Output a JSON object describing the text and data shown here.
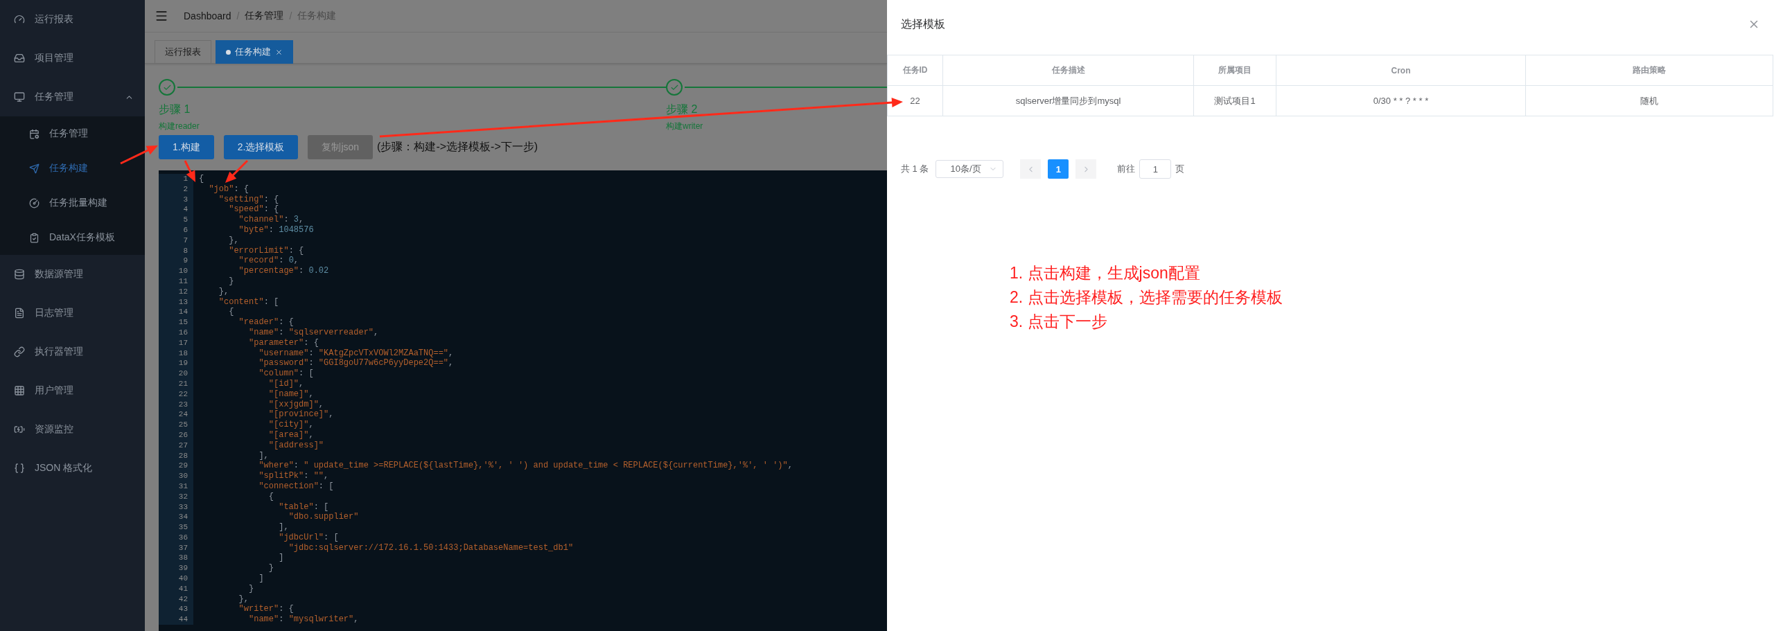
{
  "sidebar": {
    "items": [
      {
        "label": "运行报表",
        "selected": false
      },
      {
        "label": "项目管理",
        "selected": false
      },
      {
        "label": "任务管理",
        "selected": false,
        "expanded": true,
        "children": [
          {
            "label": "任务管理",
            "selected": false
          },
          {
            "label": "任务构建",
            "selected": true
          },
          {
            "label": "任务批量构建",
            "selected": false
          },
          {
            "label": "DataX任务模板",
            "selected": false
          }
        ]
      },
      {
        "label": "数据源管理",
        "selected": false
      },
      {
        "label": "日志管理",
        "selected": false
      },
      {
        "label": "执行器管理",
        "selected": false
      },
      {
        "label": "用户管理",
        "selected": false
      },
      {
        "label": "资源监控",
        "selected": false
      },
      {
        "label": "JSON 格式化",
        "selected": false
      }
    ]
  },
  "breadcrumb": [
    "Dashboard",
    "任务管理",
    "任务构建"
  ],
  "breadcrumb_separator": "/",
  "tabs": [
    {
      "label": "运行报表",
      "selected": false
    },
    {
      "label": "任务构建",
      "selected": true
    }
  ],
  "steps": [
    {
      "title": "步骤 1",
      "description": "构建reader",
      "done": true
    },
    {
      "title": "步骤 2",
      "description": "构建writer",
      "done": true
    }
  ],
  "actions": [
    {
      "label": "1.构建",
      "disabled": false
    },
    {
      "label": "2.选择模板",
      "disabled": false
    },
    {
      "label": "复制json",
      "disabled": true
    }
  ],
  "hint": "(步骤：构建->选择模板->下一步)",
  "editor": {
    "lines": [
      {
        "number": "1",
        "code": "{"
      },
      {
        "number": "2",
        "code": "  \"job\": {"
      },
      {
        "number": "3",
        "code": "    \"setting\": {"
      },
      {
        "number": "4",
        "code": "      \"speed\": {"
      },
      {
        "number": "5",
        "code": "        \"channel\": 3,"
      },
      {
        "number": "6",
        "code": "        \"byte\": 1048576"
      },
      {
        "number": "7",
        "code": "      },"
      },
      {
        "number": "8",
        "code": "      \"errorLimit\": {"
      },
      {
        "number": "9",
        "code": "        \"record\": 0,"
      },
      {
        "number": "10",
        "code": "        \"percentage\": 0.02"
      },
      {
        "number": "11",
        "code": "      }"
      },
      {
        "number": "12",
        "code": "    },"
      },
      {
        "number": "13",
        "code": "    \"content\": ["
      },
      {
        "number": "14",
        "code": "      {"
      },
      {
        "number": "15",
        "code": "        \"reader\": {"
      },
      {
        "number": "16",
        "code": "          \"name\": \"sqlserverreader\","
      },
      {
        "number": "17",
        "code": "          \"parameter\": {"
      },
      {
        "number": "18",
        "code": "            \"username\": \"KAtgZpcVTxVOWl2MZAaTNQ==\","
      },
      {
        "number": "19",
        "code": "            \"password\": \"GGI8goU77w6cP6yyDepe2Q==\","
      },
      {
        "number": "20",
        "code": "            \"column\": ["
      },
      {
        "number": "21",
        "code": "              \"[id]\","
      },
      {
        "number": "22",
        "code": "              \"[name]\","
      },
      {
        "number": "23",
        "code": "              \"[xxjgdm]\","
      },
      {
        "number": "24",
        "code": "              \"[province]\","
      },
      {
        "number": "25",
        "code": "              \"[city]\","
      },
      {
        "number": "26",
        "code": "              \"[area]\","
      },
      {
        "number": "27",
        "code": "              \"[address]\""
      },
      {
        "number": "28",
        "code": "            ],"
      },
      {
        "number": "29",
        "code": "            \"where\": \" update_time >=REPLACE(${lastTime},'%', ' ') and update_time < REPLACE(${currentTime},'%', ' ')\","
      },
      {
        "number": "30",
        "code": "            \"splitPk\": \"\","
      },
      {
        "number": "31",
        "code": "            \"connection\": ["
      },
      {
        "number": "32",
        "code": "              {"
      },
      {
        "number": "33",
        "code": "                \"table\": ["
      },
      {
        "number": "34",
        "code": "                  \"dbo.supplier\""
      },
      {
        "number": "35",
        "code": "                ],"
      },
      {
        "number": "36",
        "code": "                \"jdbcUrl\": ["
      },
      {
        "number": "37",
        "code": "                  \"jdbc:sqlserver://172.16.1.50:1433;DatabaseName=test_db1\""
      },
      {
        "number": "38",
        "code": "                ]"
      },
      {
        "number": "39",
        "code": "              }"
      },
      {
        "number": "40",
        "code": "            ]"
      },
      {
        "number": "41",
        "code": "          }"
      },
      {
        "number": "42",
        "code": "        },"
      },
      {
        "number": "43",
        "code": "        \"writer\": {"
      },
      {
        "number": "44",
        "code": "          \"name\": \"mysqlwriter\","
      }
    ]
  },
  "dialog": {
    "title": "选择模板",
    "table": {
      "columns": [
        "任务ID",
        "任务描述",
        "所属项目",
        "Cron",
        "路由策略"
      ],
      "rows": [
        [
          "22",
          "sqlserver增量同步到mysql",
          "测试项目1",
          "0/30 * * ? * * *",
          "随机"
        ]
      ]
    },
    "pagination": {
      "total": "共 1 条",
      "page_size": "10条/页",
      "pages": [
        {
          "label": "1",
          "selected": true
        }
      ],
      "goto_label": "前往",
      "goto_value": "1",
      "page_unit": "页"
    }
  },
  "annotation": {
    "lines": [
      "1. 点击构建，生成json配置",
      "2. 点击选择模板，选择需要的任务模板",
      "3. 点击下一步"
    ]
  }
}
